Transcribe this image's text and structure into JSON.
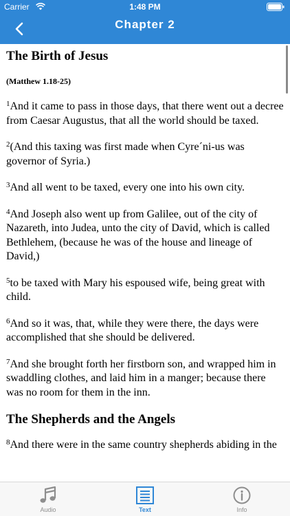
{
  "status_bar": {
    "carrier": "Carrier",
    "time": "1:48 PM"
  },
  "nav": {
    "title": "Chapter 2"
  },
  "colors": {
    "accent": "#2f87d6",
    "tab_inactive": "#8e8e8e"
  },
  "content": {
    "heading1": "The Birth of Jesus",
    "reference": "(Matthew 1.18-25)",
    "verses": [
      {
        "num": "1",
        "text": "And it came to pass in those days, that there went out a decree from Caesar Augustus, that all the world should be taxed."
      },
      {
        "num": "2",
        "text": "(And this taxing was first made when Cyre´ni-us was governor of Syria.)"
      },
      {
        "num": "3",
        "text": "And all went to be taxed, every one into his own city."
      },
      {
        "num": "4",
        "text": "And Joseph also went up from Galilee, out of the city of Nazareth, into Judea, unto the city of David, which is called Bethlehem, (because he was of the house and lineage of David,)"
      },
      {
        "num": "5",
        "text": "to be taxed with Mary his espoused wife, being great with child."
      },
      {
        "num": "6",
        "text": "And so it was, that, while they were there, the days were accomplished that she should be delivered."
      },
      {
        "num": "7",
        "text": "And she brought forth her firstborn son, and wrapped him in swaddling clothes, and laid him in a manger; because there was no room for them in the inn."
      }
    ],
    "heading2": "The Shepherds and the Angels",
    "verse8": {
      "num": "8",
      "text": "And there were in the same country shepherds abiding in the"
    }
  },
  "tabs": [
    {
      "label": "Audio",
      "icon": "music-note-icon"
    },
    {
      "label": "Text",
      "icon": "text-document-icon"
    },
    {
      "label": "Info",
      "icon": "info-icon"
    }
  ]
}
